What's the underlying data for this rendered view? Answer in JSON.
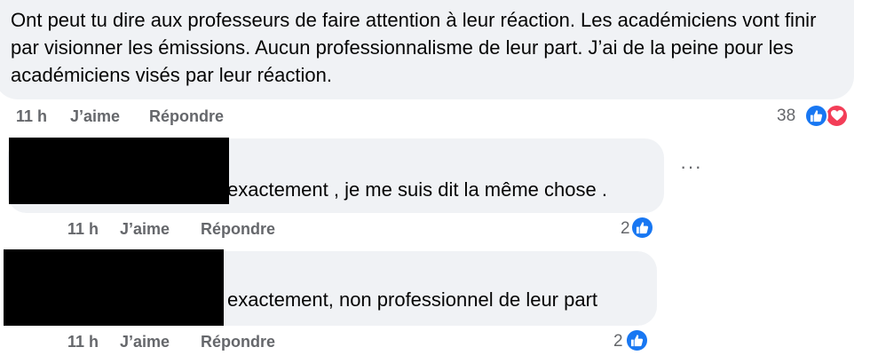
{
  "main_comment": {
    "text": "Ont peut tu dire aux professeurs de faire attention à leur réaction. Les académiciens vont finir par visionner les émissions. Aucun professionnalisme de leur part. J’ai de la peine pour les académiciens visés par leur réaction.",
    "time": "11 h",
    "like_label": "J’aime",
    "reply_label": "Répondre",
    "reaction_count": "38"
  },
  "replies": [
    {
      "text": "exactement , je me suis dit la même chose .",
      "time": "11 h",
      "like_label": "J’aime",
      "reply_label": "Répondre",
      "reaction_count": "2"
    },
    {
      "text": "exactement, non professionnel de leur part",
      "time": "11 h",
      "like_label": "J’aime",
      "reply_label": "Répondre",
      "reaction_count": "2"
    }
  ],
  "more_options": "···",
  "colors": {
    "like": "#1877f2",
    "love": "#f33e58",
    "bubble": "#f0f2f5",
    "meta": "#65676b"
  },
  "icons": [
    "like-icon",
    "heart-icon",
    "more-options-icon"
  ]
}
